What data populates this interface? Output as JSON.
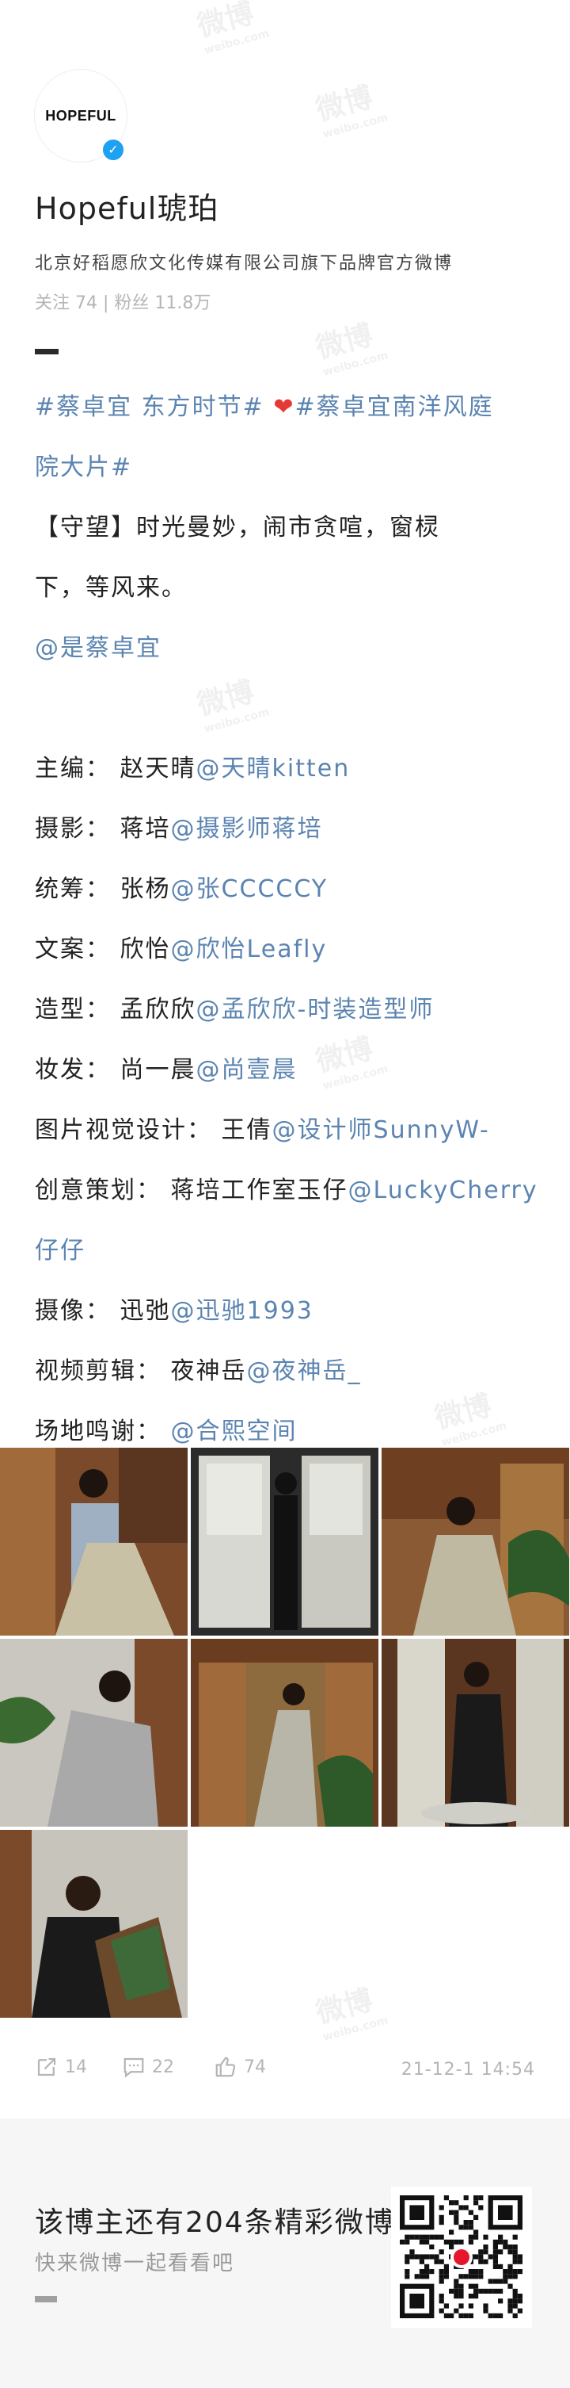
{
  "watermark": {
    "text": "微博",
    "sub": "weibo.com"
  },
  "profile": {
    "logo_text": "HOPEFUL",
    "name": "Hopeful琥珀",
    "bio": "北京好稻愿欣文化传媒有限公司旗下品牌官方微博",
    "stats": "关注 74 | 粉丝 11.8万"
  },
  "post": {
    "tag1": "#蔡卓宜 东方时节#",
    "tag2_a": "#蔡卓宜南洋风庭",
    "tag2_b": "院大片#",
    "body_line1": "【守望】时光曼妙，闹市贪喧，窗棂",
    "body_line2": "下，等风来。",
    "mention_main": "@是蔡卓宜",
    "credits": [
      {
        "label": "主编：",
        "person": "赵天晴",
        "link": "@天晴kitten"
      },
      {
        "label": "摄影：",
        "person": "蒋培",
        "link": "@摄影师蒋培"
      },
      {
        "label": "统筹：",
        "person": "张杨",
        "link": "@张CCCCCY"
      },
      {
        "label": "文案：",
        "person": "欣怡",
        "link": "@欣怡Leafly"
      },
      {
        "label": "造型：",
        "person": "孟欣欣",
        "link": "@孟欣欣-时装造型师"
      },
      {
        "label": "妆发：",
        "person": "尚一晨",
        "link": "@尚壹晨"
      },
      {
        "label": "图片视觉设计：",
        "person": "王倩",
        "link": "@设计师SunnyW-"
      },
      {
        "label": "创意策划：",
        "person": "蒋培工作室玉仔",
        "link": "@LuckyCherry",
        "cont": "仔仔"
      },
      {
        "label": "摄像：",
        "person": "迅弛",
        "link": "@迅驰1993"
      },
      {
        "label": "视频剪辑：",
        "person": "夜神岳",
        "link": "@夜神岳_"
      },
      {
        "label": "场地鸣谢：",
        "person": "",
        "link": "@合熙空间"
      }
    ]
  },
  "actions": {
    "reposts": "14",
    "comments": "22",
    "likes": "74",
    "timestamp": "21-12-1 14:54"
  },
  "footer": {
    "title": "该博主还有204条精彩微博",
    "subtitle": "快来微博一起看看吧"
  },
  "colors": {
    "link": "#5b84b1",
    "muted": "#b5b5b5",
    "footer_bg": "#f6f6f6"
  }
}
